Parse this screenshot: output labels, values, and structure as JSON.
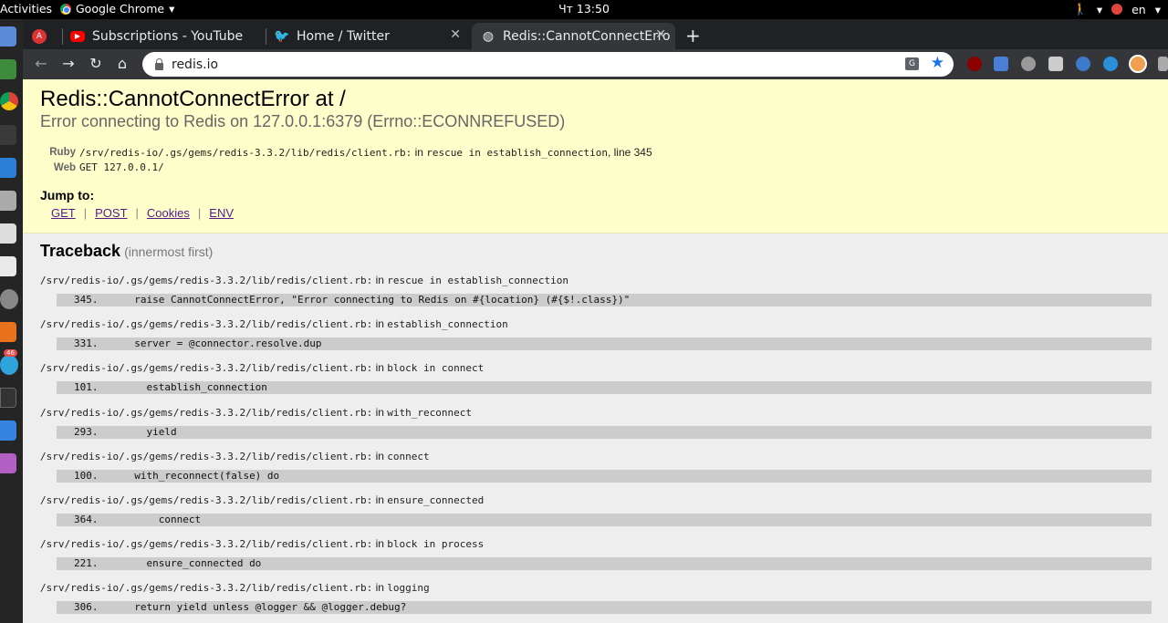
{
  "system": {
    "activities": "Activities",
    "app_name": "Google Chrome",
    "app_caret": "▾",
    "clock": "Чт 13:50",
    "lang": "en",
    "dock_badge": "46"
  },
  "tabs": [
    {
      "title": "Subscriptions - YouTube",
      "close": "✕"
    },
    {
      "title": "Home / Twitter",
      "close": "✕"
    },
    {
      "title": "Redis::CannotConnectErro",
      "close": "✕"
    }
  ],
  "new_tab": "+",
  "nav": {
    "back": "←",
    "forward": "→",
    "reload": "↻",
    "home": "⌂"
  },
  "omnibox": {
    "url": "redis.io",
    "translate": "G",
    "bookmark": "★"
  },
  "colors": {
    "accent": "#1a73e8",
    "summary_bg": "#ffffcc",
    "link": "#551a8b"
  },
  "error": {
    "title": "Redis::CannotConnectError at /",
    "subtitle": "Error connecting to Redis on 127.0.0.1:6379 (Errno::ECONNREFUSED)",
    "ruby_label": "Ruby",
    "ruby_path": "/srv/redis-io/.gs/gems/redis-3.3.2/lib/redis/client.rb:",
    "ruby_in": " in ",
    "ruby_method": "rescue in establish_connection",
    "ruby_line": ", line 345",
    "web_label": "Web",
    "web_value": "GET 127.0.0.1/",
    "jump_to": "Jump to:",
    "jump_links": [
      "GET",
      "POST",
      "Cookies",
      "ENV"
    ],
    "jump_sep": "|"
  },
  "traceback": {
    "title": "Traceback",
    "subtitle": "(innermost first)",
    "frames": [
      {
        "file": "/srv/redis-io/.gs/gems/redis-3.3.2/lib/redis/client.rb:",
        "in": " in ",
        "method": "rescue in establish_connection",
        "line": "345.",
        "code": "      raise CannotConnectError, \"Error connecting to Redis on #{location} (#{$!.class})\""
      },
      {
        "file": "/srv/redis-io/.gs/gems/redis-3.3.2/lib/redis/client.rb:",
        "in": " in ",
        "method": "establish_connection",
        "line": "331.",
        "code": "      server = @connector.resolve.dup"
      },
      {
        "file": "/srv/redis-io/.gs/gems/redis-3.3.2/lib/redis/client.rb:",
        "in": " in ",
        "method": "block in connect",
        "line": "101.",
        "code": "        establish_connection"
      },
      {
        "file": "/srv/redis-io/.gs/gems/redis-3.3.2/lib/redis/client.rb:",
        "in": " in ",
        "method": "with_reconnect",
        "line": "293.",
        "code": "        yield"
      },
      {
        "file": "/srv/redis-io/.gs/gems/redis-3.3.2/lib/redis/client.rb:",
        "in": " in ",
        "method": "connect",
        "line": "100.",
        "code": "      with_reconnect(false) do"
      },
      {
        "file": "/srv/redis-io/.gs/gems/redis-3.3.2/lib/redis/client.rb:",
        "in": " in ",
        "method": "ensure_connected",
        "line": "364.",
        "code": "          connect"
      },
      {
        "file": "/srv/redis-io/.gs/gems/redis-3.3.2/lib/redis/client.rb:",
        "in": " in ",
        "method": "block in process",
        "line": "221.",
        "code": "        ensure_connected do"
      },
      {
        "file": "/srv/redis-io/.gs/gems/redis-3.3.2/lib/redis/client.rb:",
        "in": " in ",
        "method": "logging",
        "line": "306.",
        "code": "      return yield unless @logger && @logger.debug?"
      }
    ]
  }
}
